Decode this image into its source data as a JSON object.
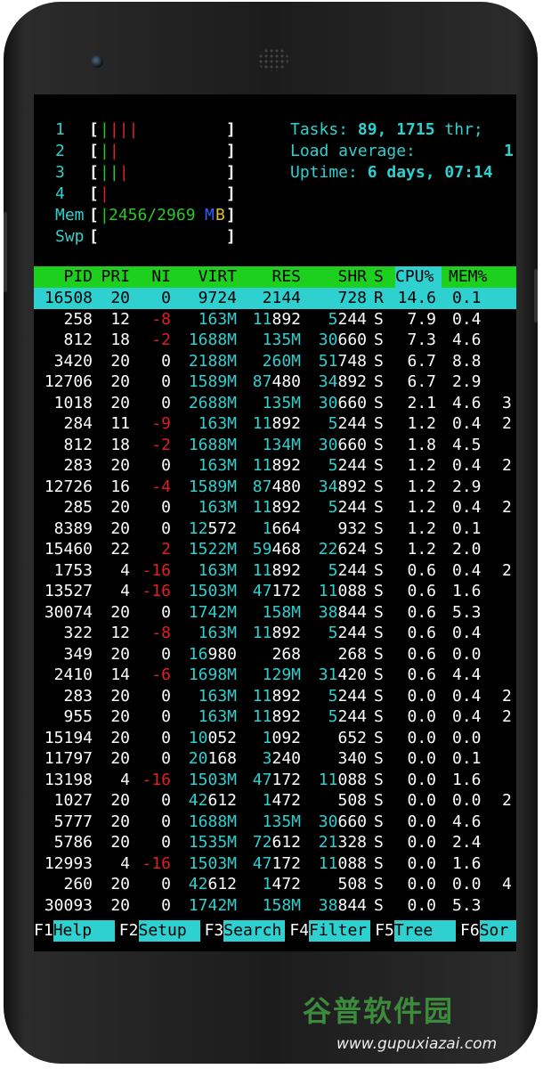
{
  "meters": {
    "cpu1": {
      "label": "1",
      "open": "[",
      "bar": "||||",
      "close": "]"
    },
    "cpu2": {
      "label": "2",
      "open": "[",
      "bar": "||",
      "close": "]"
    },
    "cpu3": {
      "label": "3",
      "open": "[",
      "bar": "|||",
      "close": "]"
    },
    "cpu4": {
      "label": "4",
      "open": "[",
      "bar": "|",
      "close": "]"
    },
    "mem": {
      "label": "Mem",
      "open": "[",
      "bar": "|",
      "value": "2456/2969",
      "unit_m": "M",
      "unit_b": "B",
      "close": "]"
    },
    "swp": {
      "label": "Swp",
      "open": "[",
      "close": "]"
    }
  },
  "summary": {
    "tasks_label": "Tasks: ",
    "tasks_value": "89, 1715",
    "tasks_suffix": " thr;",
    "load_label": "Load average:",
    "load_value": "1",
    "uptime_label": "Uptime: ",
    "uptime_value": "6 days, 07:14"
  },
  "columns": [
    "PID",
    "PRI",
    "NI",
    "VIRT",
    "RES",
    "SHR",
    "S",
    "CPU%",
    "MEM%"
  ],
  "processes": [
    {
      "pid": "16508",
      "pri": "20",
      "ni": "0",
      "virt": "9724",
      "res": "2144",
      "shr": "728",
      "s": "R",
      "cpu": "14.6",
      "mem": "0.1",
      "extra": ""
    },
    {
      "pid": "258",
      "pri": "12",
      "ni": "-8",
      "virt": "163M",
      "res": "11892",
      "shr": "5244",
      "s": "S",
      "cpu": "7.9",
      "mem": "0.4",
      "extra": ""
    },
    {
      "pid": "812",
      "pri": "18",
      "ni": "-2",
      "virt": "1688M",
      "res": "135M",
      "shr": "30660",
      "s": "S",
      "cpu": "7.3",
      "mem": "4.6",
      "extra": ""
    },
    {
      "pid": "3420",
      "pri": "20",
      "ni": "0",
      "virt": "2188M",
      "res": "260M",
      "shr": "51748",
      "s": "S",
      "cpu": "6.7",
      "mem": "8.8",
      "extra": ""
    },
    {
      "pid": "12706",
      "pri": "20",
      "ni": "0",
      "virt": "1589M",
      "res": "87480",
      "shr": "34892",
      "s": "S",
      "cpu": "6.7",
      "mem": "2.9",
      "extra": ""
    },
    {
      "pid": "1018",
      "pri": "20",
      "ni": "0",
      "virt": "2688M",
      "res": "135M",
      "shr": "30660",
      "s": "S",
      "cpu": "2.1",
      "mem": "4.6",
      "extra": "3"
    },
    {
      "pid": "284",
      "pri": "11",
      "ni": "-9",
      "virt": "163M",
      "res": "11892",
      "shr": "5244",
      "s": "S",
      "cpu": "1.2",
      "mem": "0.4",
      "extra": "2"
    },
    {
      "pid": "812",
      "pri": "18",
      "ni": "-2",
      "virt": "1688M",
      "res": "134M",
      "shr": "30660",
      "s": "S",
      "cpu": "1.8",
      "mem": "4.5",
      "extra": ""
    },
    {
      "pid": "283",
      "pri": "20",
      "ni": "0",
      "virt": "163M",
      "res": "11892",
      "shr": "5244",
      "s": "S",
      "cpu": "1.2",
      "mem": "0.4",
      "extra": "2"
    },
    {
      "pid": "12726",
      "pri": "16",
      "ni": "-4",
      "virt": "1589M",
      "res": "87480",
      "shr": "34892",
      "s": "S",
      "cpu": "1.2",
      "mem": "2.9",
      "extra": ""
    },
    {
      "pid": "285",
      "pri": "20",
      "ni": "0",
      "virt": "163M",
      "res": "11892",
      "shr": "5244",
      "s": "S",
      "cpu": "1.2",
      "mem": "0.4",
      "extra": "2"
    },
    {
      "pid": "8389",
      "pri": "20",
      "ni": "0",
      "virt": "12572",
      "res": "1664",
      "shr": "932",
      "s": "S",
      "cpu": "1.2",
      "mem": "0.1",
      "extra": ""
    },
    {
      "pid": "15460",
      "pri": "22",
      "ni": "2",
      "virt": "1522M",
      "res": "59468",
      "shr": "22624",
      "s": "S",
      "cpu": "1.2",
      "mem": "2.0",
      "extra": ""
    },
    {
      "pid": "1753",
      "pri": "4",
      "ni": "-16",
      "virt": "163M",
      "res": "11892",
      "shr": "5244",
      "s": "S",
      "cpu": "0.6",
      "mem": "0.4",
      "extra": "2"
    },
    {
      "pid": "13527",
      "pri": "4",
      "ni": "-16",
      "virt": "1503M",
      "res": "47172",
      "shr": "11088",
      "s": "S",
      "cpu": "0.6",
      "mem": "1.6",
      "extra": ""
    },
    {
      "pid": "30074",
      "pri": "20",
      "ni": "0",
      "virt": "1742M",
      "res": "158M",
      "shr": "38844",
      "s": "S",
      "cpu": "0.6",
      "mem": "5.3",
      "extra": ""
    },
    {
      "pid": "322",
      "pri": "12",
      "ni": "-8",
      "virt": "163M",
      "res": "11892",
      "shr": "5244",
      "s": "S",
      "cpu": "0.6",
      "mem": "0.4",
      "extra": ""
    },
    {
      "pid": "349",
      "pri": "20",
      "ni": "0",
      "virt": "16980",
      "res": "268",
      "shr": "268",
      "s": "S",
      "cpu": "0.6",
      "mem": "0.0",
      "extra": ""
    },
    {
      "pid": "2410",
      "pri": "14",
      "ni": "-6",
      "virt": "1698M",
      "res": "129M",
      "shr": "31420",
      "s": "S",
      "cpu": "0.6",
      "mem": "4.4",
      "extra": ""
    },
    {
      "pid": "283",
      "pri": "20",
      "ni": "0",
      "virt": "163M",
      "res": "11892",
      "shr": "5244",
      "s": "S",
      "cpu": "0.0",
      "mem": "0.4",
      "extra": "2"
    },
    {
      "pid": "955",
      "pri": "20",
      "ni": "0",
      "virt": "163M",
      "res": "11892",
      "shr": "5244",
      "s": "S",
      "cpu": "0.0",
      "mem": "0.4",
      "extra": "2"
    },
    {
      "pid": "15194",
      "pri": "20",
      "ni": "0",
      "virt": "10052",
      "res": "1092",
      "shr": "652",
      "s": "S",
      "cpu": "0.0",
      "mem": "0.0",
      "extra": ""
    },
    {
      "pid": "11797",
      "pri": "20",
      "ni": "0",
      "virt": "20168",
      "res": "3240",
      "shr": "340",
      "s": "S",
      "cpu": "0.0",
      "mem": "0.1",
      "extra": ""
    },
    {
      "pid": "13198",
      "pri": "4",
      "ni": "-16",
      "virt": "1503M",
      "res": "47172",
      "shr": "11088",
      "s": "S",
      "cpu": "0.0",
      "mem": "1.6",
      "extra": ""
    },
    {
      "pid": "1027",
      "pri": "20",
      "ni": "0",
      "virt": "42612",
      "res": "1472",
      "shr": "508",
      "s": "S",
      "cpu": "0.0",
      "mem": "0.0",
      "extra": "2"
    },
    {
      "pid": "5777",
      "pri": "20",
      "ni": "0",
      "virt": "1688M",
      "res": "135M",
      "shr": "30660",
      "s": "S",
      "cpu": "0.0",
      "mem": "4.6",
      "extra": ""
    },
    {
      "pid": "5786",
      "pri": "20",
      "ni": "0",
      "virt": "1535M",
      "res": "72612",
      "shr": "21328",
      "s": "S",
      "cpu": "0.0",
      "mem": "2.4",
      "extra": ""
    },
    {
      "pid": "12993",
      "pri": "4",
      "ni": "-16",
      "virt": "1503M",
      "res": "47172",
      "shr": "11088",
      "s": "S",
      "cpu": "0.0",
      "mem": "1.6",
      "extra": ""
    },
    {
      "pid": "260",
      "pri": "20",
      "ni": "0",
      "virt": "42612",
      "res": "1472",
      "shr": "508",
      "s": "S",
      "cpu": "0.0",
      "mem": "0.0",
      "extra": "4"
    },
    {
      "pid": "30093",
      "pri": "20",
      "ni": "0",
      "virt": "1742M",
      "res": "158M",
      "shr": "38844",
      "s": "S",
      "cpu": "0.0",
      "mem": "5.3",
      "extra": ""
    }
  ],
  "fkeys": [
    {
      "key": "F1",
      "label": "Help"
    },
    {
      "key": "F2",
      "label": "Setup"
    },
    {
      "key": "F3",
      "label": "Search"
    },
    {
      "key": "F4",
      "label": "Filter"
    },
    {
      "key": "F5",
      "label": "Tree"
    },
    {
      "key": "F6",
      "label": "Sor"
    }
  ],
  "watermark": {
    "title": "谷普软件园",
    "url": "www.gupuxiazai.com"
  },
  "colors": {
    "cyan": "#2fd0d0",
    "green": "#1ed01e",
    "red": "#e02020",
    "blue": "#3060ff",
    "yellow": "#e0c020"
  }
}
